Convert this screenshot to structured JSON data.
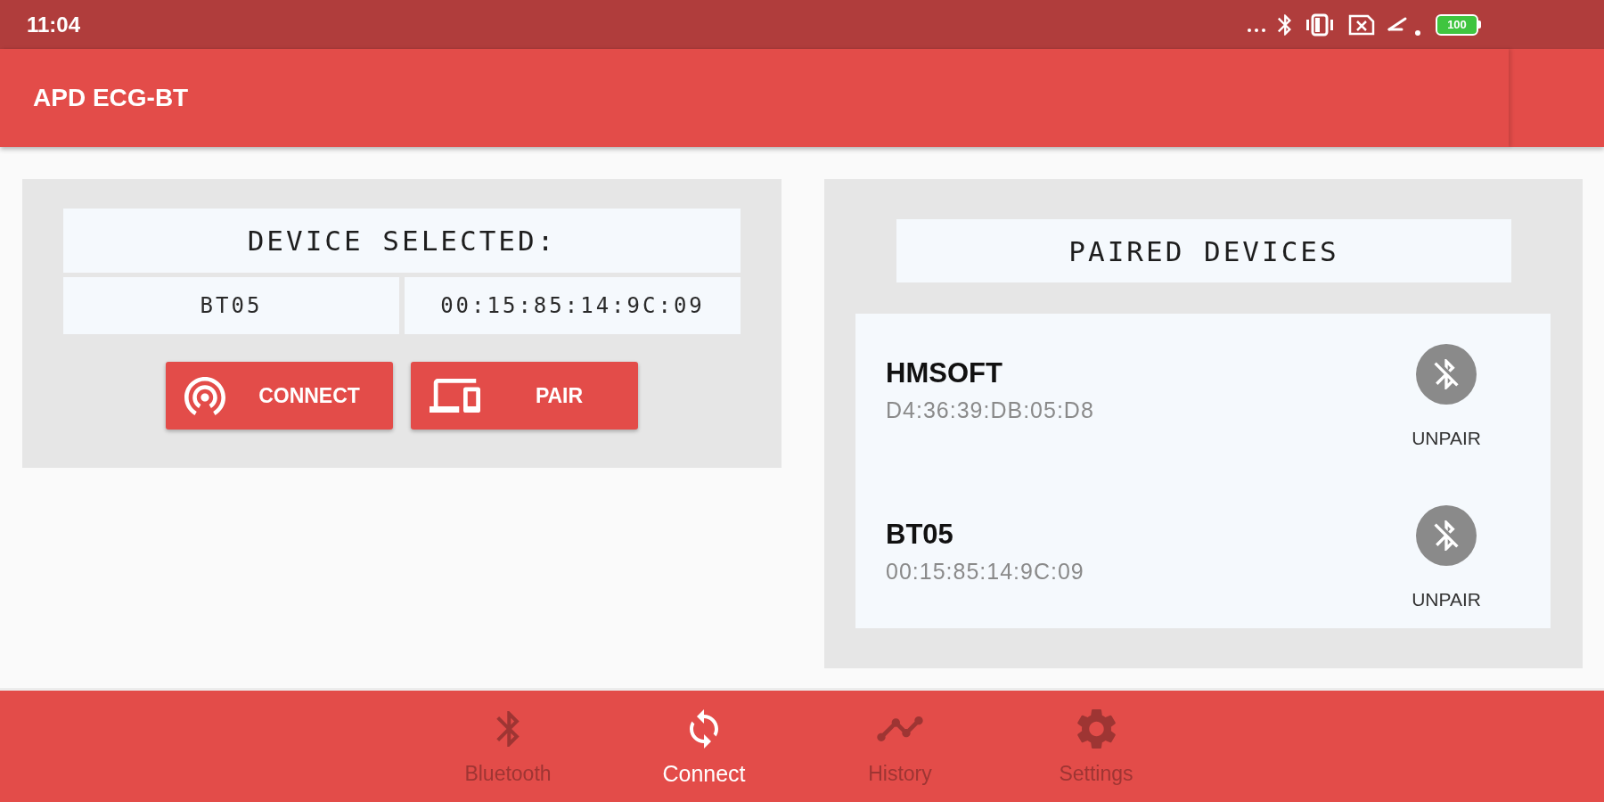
{
  "status_bar": {
    "time": "11:04",
    "battery": "100"
  },
  "app_bar": {
    "title": "APD ECG-BT"
  },
  "device_selected": {
    "title": "DEVICE SELECTED:",
    "name": "BT05",
    "address": "00:15:85:14:9C:09",
    "buttons": [
      {
        "label": "CONNECT",
        "kind": "connect"
      },
      {
        "label": "PAIR",
        "kind": "pair"
      }
    ]
  },
  "paired_devices": {
    "title": "PAIRED DEVICES",
    "devices": [
      {
        "name": "HMSOFT",
        "address": "D4:36:39:DB:05:D8",
        "action": "UNPAIR"
      },
      {
        "name": "BT05",
        "address": "00:15:85:14:9C:09",
        "action": "UNPAIR"
      }
    ]
  },
  "bottom_nav": [
    {
      "label": "Bluetooth",
      "kind": "bluetooth",
      "selected": false
    },
    {
      "label": "Connect",
      "kind": "connect",
      "selected": true
    },
    {
      "label": "History",
      "kind": "history",
      "selected": false
    },
    {
      "label": "Settings",
      "kind": "settings",
      "selected": false
    }
  ]
}
